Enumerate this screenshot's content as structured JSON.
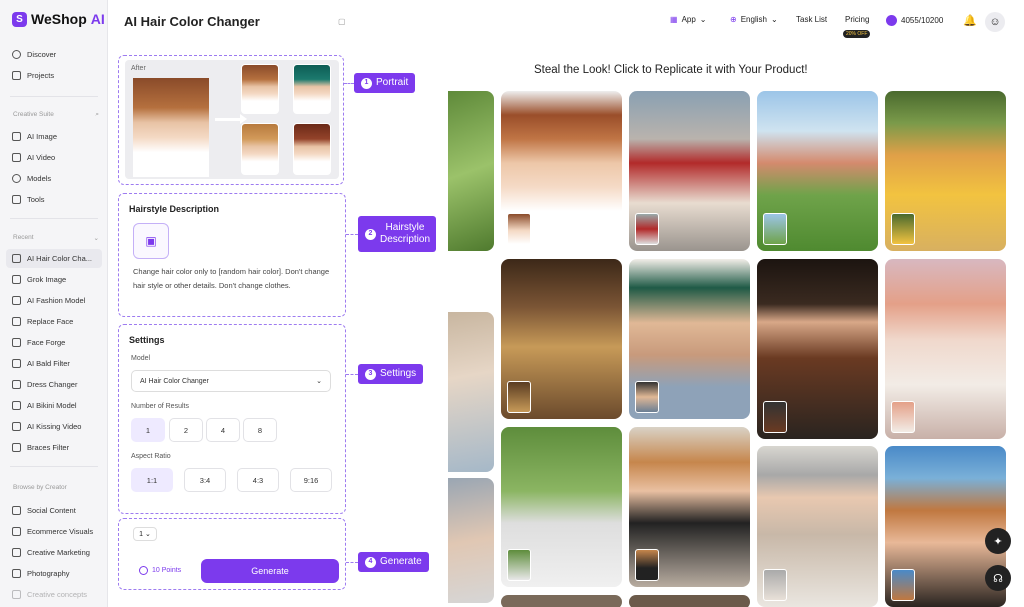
{
  "app": {
    "logo_text": "WeShop",
    "logo_ai": "AI",
    "page_title": "AI Hair Color Changer"
  },
  "header": {
    "app_label": "App",
    "language": "English",
    "task_list": "Task List",
    "pricing": "Pricing",
    "pricing_badge": "20% OFF",
    "points": "4055/10200"
  },
  "sidebar": {
    "top": [
      {
        "label": "Discover",
        "icon": "compass-icon"
      },
      {
        "label": "Projects",
        "icon": "folder-icon"
      }
    ],
    "creative_suite_heading": "Creative Suite",
    "creative": [
      {
        "label": "AI Image",
        "icon": "image-icon"
      },
      {
        "label": "AI Video",
        "icon": "video-icon"
      },
      {
        "label": "Models",
        "icon": "models-icon"
      },
      {
        "label": "Tools",
        "icon": "tools-icon"
      }
    ],
    "recent_heading": "Recent",
    "recent": [
      {
        "label": "AI Hair Color Cha..."
      },
      {
        "label": "Grok Image"
      },
      {
        "label": "AI Fashion Model"
      },
      {
        "label": "Replace Face"
      },
      {
        "label": "Face Forge"
      },
      {
        "label": "AI Bald Filter"
      },
      {
        "label": "Dress Changer"
      },
      {
        "label": "AI Bikini Model"
      },
      {
        "label": "AI Kissing Video"
      },
      {
        "label": "Braces Filter"
      }
    ],
    "browse_heading": "Browse by Creator",
    "browse": [
      {
        "label": "Social Content"
      },
      {
        "label": "Ecommerce Visuals"
      },
      {
        "label": "Creative Marketing"
      },
      {
        "label": "Photography"
      },
      {
        "label": "Creative concepts"
      }
    ]
  },
  "portrait": {
    "after_label": "After"
  },
  "hairstyle": {
    "title": "Hairstyle Description",
    "text": "Change hair color only to [random hair color]. Don't change hair style or other details. Don't change clothes."
  },
  "settings": {
    "title": "Settings",
    "model_label": "Model",
    "model_value": "AI Hair Color Changer",
    "results_label": "Number of Results",
    "results": [
      "1",
      "2",
      "4",
      "8"
    ],
    "aspect_label": "Aspect Ratio",
    "aspects": [
      "1:1",
      "3:4",
      "4:3",
      "9:16"
    ]
  },
  "generate": {
    "count": "1",
    "points": "10 Points",
    "button": "Generate"
  },
  "callouts": [
    {
      "num": "1",
      "text": "Portrait"
    },
    {
      "num": "2",
      "text": "Hairstyle Description"
    },
    {
      "num": "3",
      "text": "Settings"
    },
    {
      "num": "4",
      "text": "Generate"
    }
  ],
  "gallery": {
    "title": "Steal the Look! Click to Replicate it with Your Product!"
  },
  "colors": {
    "accent": "#7c3aed"
  }
}
